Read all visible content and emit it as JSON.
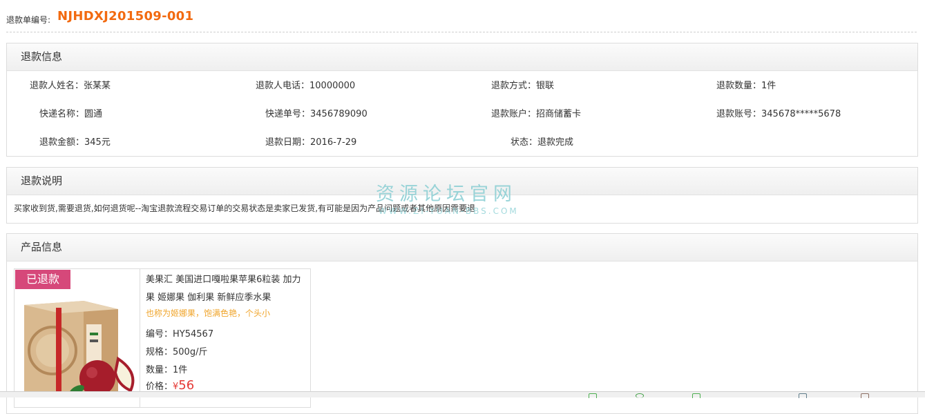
{
  "header": {
    "label": "退款单编号:",
    "number": "NJHDXJ201509-001"
  },
  "refund_info": {
    "title": "退款信息",
    "fields": [
      {
        "label": "退款人姓名：",
        "value": "张某某"
      },
      {
        "label": "退款人电话：",
        "value": "10000000"
      },
      {
        "label": "退款方式：",
        "value": "银联"
      },
      {
        "label": "退款数量：",
        "value": "1件"
      },
      {
        "label": "快递名称：",
        "value": "圆通"
      },
      {
        "label": "快递单号：",
        "value": "3456789090"
      },
      {
        "label": "退款账户：",
        "value": "招商储蓄卡"
      },
      {
        "label": "退款账号：",
        "value": "345678*****5678"
      },
      {
        "label": "退款金额：",
        "value": "345元"
      },
      {
        "label": "退款日期：",
        "value": "2016-7-29"
      },
      {
        "label": "状态：",
        "value": "退款完成"
      }
    ]
  },
  "refund_note": {
    "title": "退款说明",
    "text": "买家收到货,需要退货,如何退货呢--淘宝退款流程交易订单的交易状态是卖家已发货,有可能是因为产品问题或者其他原因需要退"
  },
  "watermark": {
    "line1": "资源论坛官网",
    "line2": "WWW.ZI-YUAN-BBS.COM"
  },
  "product_info": {
    "title": "产品信息",
    "badge": "已退款",
    "name": "美果汇 美国进口嘎啦果苹果6粒装 加力果 姬娜果 伽利果 新鲜应季水果",
    "subtitle": "也称为姬娜果，饱满色艳，个头小",
    "code_label": "编号：",
    "code": "HY54567",
    "spec_label": "规格：",
    "spec": "500g/斤",
    "qty_label": "数量：",
    "qty": "1件",
    "price_label": "价格：",
    "currency": "¥",
    "price": "56"
  },
  "colors": {
    "accent": "#f26a10",
    "badge": "#d6487a",
    "price": "#e53935",
    "subtitle": "#f0a52b"
  }
}
